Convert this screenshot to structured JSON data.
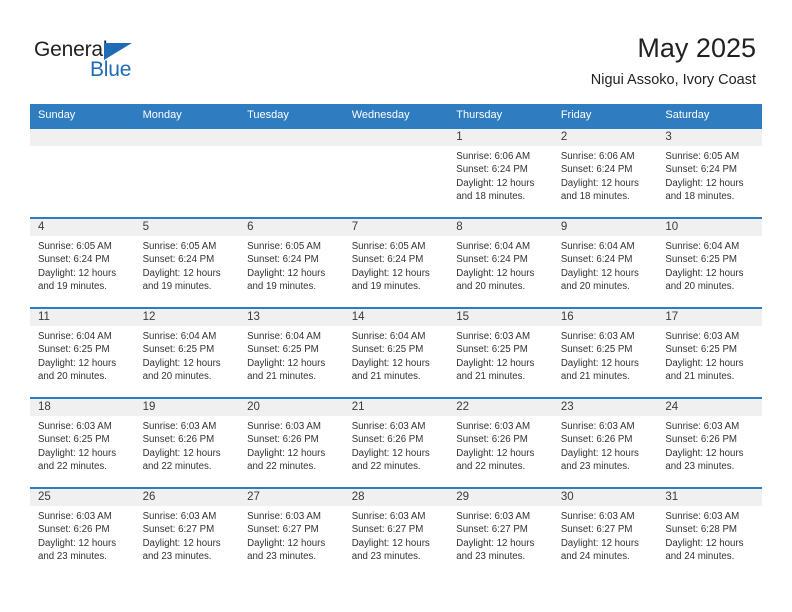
{
  "brand": {
    "name_top": "General",
    "name_bottom": "Blue",
    "accent_color": "#1f6cb4"
  },
  "header": {
    "title": "May 2025",
    "subtitle": "Nigui Assoko, Ivory Coast"
  },
  "theme": {
    "header_row_color": "#2f7cc0",
    "daynum_band_color": "#f0f0f0",
    "cell_background": "#ffffff",
    "text_color": "#333333"
  },
  "weekday_headers": [
    "Sunday",
    "Monday",
    "Tuesday",
    "Wednesday",
    "Thursday",
    "Friday",
    "Saturday"
  ],
  "weeks": [
    [
      {
        "day": "",
        "sunrise": "",
        "sunset": "",
        "daylight_line1": "",
        "daylight_line2": ""
      },
      {
        "day": "",
        "sunrise": "",
        "sunset": "",
        "daylight_line1": "",
        "daylight_line2": ""
      },
      {
        "day": "",
        "sunrise": "",
        "sunset": "",
        "daylight_line1": "",
        "daylight_line2": ""
      },
      {
        "day": "",
        "sunrise": "",
        "sunset": "",
        "daylight_line1": "",
        "daylight_line2": ""
      },
      {
        "day": "1",
        "sunrise": "Sunrise: 6:06 AM",
        "sunset": "Sunset: 6:24 PM",
        "daylight_line1": "Daylight: 12 hours",
        "daylight_line2": "and 18 minutes."
      },
      {
        "day": "2",
        "sunrise": "Sunrise: 6:06 AM",
        "sunset": "Sunset: 6:24 PM",
        "daylight_line1": "Daylight: 12 hours",
        "daylight_line2": "and 18 minutes."
      },
      {
        "day": "3",
        "sunrise": "Sunrise: 6:05 AM",
        "sunset": "Sunset: 6:24 PM",
        "daylight_line1": "Daylight: 12 hours",
        "daylight_line2": "and 18 minutes."
      }
    ],
    [
      {
        "day": "4",
        "sunrise": "Sunrise: 6:05 AM",
        "sunset": "Sunset: 6:24 PM",
        "daylight_line1": "Daylight: 12 hours",
        "daylight_line2": "and 19 minutes."
      },
      {
        "day": "5",
        "sunrise": "Sunrise: 6:05 AM",
        "sunset": "Sunset: 6:24 PM",
        "daylight_line1": "Daylight: 12 hours",
        "daylight_line2": "and 19 minutes."
      },
      {
        "day": "6",
        "sunrise": "Sunrise: 6:05 AM",
        "sunset": "Sunset: 6:24 PM",
        "daylight_line1": "Daylight: 12 hours",
        "daylight_line2": "and 19 minutes."
      },
      {
        "day": "7",
        "sunrise": "Sunrise: 6:05 AM",
        "sunset": "Sunset: 6:24 PM",
        "daylight_line1": "Daylight: 12 hours",
        "daylight_line2": "and 19 minutes."
      },
      {
        "day": "8",
        "sunrise": "Sunrise: 6:04 AM",
        "sunset": "Sunset: 6:24 PM",
        "daylight_line1": "Daylight: 12 hours",
        "daylight_line2": "and 20 minutes."
      },
      {
        "day": "9",
        "sunrise": "Sunrise: 6:04 AM",
        "sunset": "Sunset: 6:24 PM",
        "daylight_line1": "Daylight: 12 hours",
        "daylight_line2": "and 20 minutes."
      },
      {
        "day": "10",
        "sunrise": "Sunrise: 6:04 AM",
        "sunset": "Sunset: 6:25 PM",
        "daylight_line1": "Daylight: 12 hours",
        "daylight_line2": "and 20 minutes."
      }
    ],
    [
      {
        "day": "11",
        "sunrise": "Sunrise: 6:04 AM",
        "sunset": "Sunset: 6:25 PM",
        "daylight_line1": "Daylight: 12 hours",
        "daylight_line2": "and 20 minutes."
      },
      {
        "day": "12",
        "sunrise": "Sunrise: 6:04 AM",
        "sunset": "Sunset: 6:25 PM",
        "daylight_line1": "Daylight: 12 hours",
        "daylight_line2": "and 20 minutes."
      },
      {
        "day": "13",
        "sunrise": "Sunrise: 6:04 AM",
        "sunset": "Sunset: 6:25 PM",
        "daylight_line1": "Daylight: 12 hours",
        "daylight_line2": "and 21 minutes."
      },
      {
        "day": "14",
        "sunrise": "Sunrise: 6:04 AM",
        "sunset": "Sunset: 6:25 PM",
        "daylight_line1": "Daylight: 12 hours",
        "daylight_line2": "and 21 minutes."
      },
      {
        "day": "15",
        "sunrise": "Sunrise: 6:03 AM",
        "sunset": "Sunset: 6:25 PM",
        "daylight_line1": "Daylight: 12 hours",
        "daylight_line2": "and 21 minutes."
      },
      {
        "day": "16",
        "sunrise": "Sunrise: 6:03 AM",
        "sunset": "Sunset: 6:25 PM",
        "daylight_line1": "Daylight: 12 hours",
        "daylight_line2": "and 21 minutes."
      },
      {
        "day": "17",
        "sunrise": "Sunrise: 6:03 AM",
        "sunset": "Sunset: 6:25 PM",
        "daylight_line1": "Daylight: 12 hours",
        "daylight_line2": "and 21 minutes."
      }
    ],
    [
      {
        "day": "18",
        "sunrise": "Sunrise: 6:03 AM",
        "sunset": "Sunset: 6:25 PM",
        "daylight_line1": "Daylight: 12 hours",
        "daylight_line2": "and 22 minutes."
      },
      {
        "day": "19",
        "sunrise": "Sunrise: 6:03 AM",
        "sunset": "Sunset: 6:26 PM",
        "daylight_line1": "Daylight: 12 hours",
        "daylight_line2": "and 22 minutes."
      },
      {
        "day": "20",
        "sunrise": "Sunrise: 6:03 AM",
        "sunset": "Sunset: 6:26 PM",
        "daylight_line1": "Daylight: 12 hours",
        "daylight_line2": "and 22 minutes."
      },
      {
        "day": "21",
        "sunrise": "Sunrise: 6:03 AM",
        "sunset": "Sunset: 6:26 PM",
        "daylight_line1": "Daylight: 12 hours",
        "daylight_line2": "and 22 minutes."
      },
      {
        "day": "22",
        "sunrise": "Sunrise: 6:03 AM",
        "sunset": "Sunset: 6:26 PM",
        "daylight_line1": "Daylight: 12 hours",
        "daylight_line2": "and 22 minutes."
      },
      {
        "day": "23",
        "sunrise": "Sunrise: 6:03 AM",
        "sunset": "Sunset: 6:26 PM",
        "daylight_line1": "Daylight: 12 hours",
        "daylight_line2": "and 23 minutes."
      },
      {
        "day": "24",
        "sunrise": "Sunrise: 6:03 AM",
        "sunset": "Sunset: 6:26 PM",
        "daylight_line1": "Daylight: 12 hours",
        "daylight_line2": "and 23 minutes."
      }
    ],
    [
      {
        "day": "25",
        "sunrise": "Sunrise: 6:03 AM",
        "sunset": "Sunset: 6:26 PM",
        "daylight_line1": "Daylight: 12 hours",
        "daylight_line2": "and 23 minutes."
      },
      {
        "day": "26",
        "sunrise": "Sunrise: 6:03 AM",
        "sunset": "Sunset: 6:27 PM",
        "daylight_line1": "Daylight: 12 hours",
        "daylight_line2": "and 23 minutes."
      },
      {
        "day": "27",
        "sunrise": "Sunrise: 6:03 AM",
        "sunset": "Sunset: 6:27 PM",
        "daylight_line1": "Daylight: 12 hours",
        "daylight_line2": "and 23 minutes."
      },
      {
        "day": "28",
        "sunrise": "Sunrise: 6:03 AM",
        "sunset": "Sunset: 6:27 PM",
        "daylight_line1": "Daylight: 12 hours",
        "daylight_line2": "and 23 minutes."
      },
      {
        "day": "29",
        "sunrise": "Sunrise: 6:03 AM",
        "sunset": "Sunset: 6:27 PM",
        "daylight_line1": "Daylight: 12 hours",
        "daylight_line2": "and 23 minutes."
      },
      {
        "day": "30",
        "sunrise": "Sunrise: 6:03 AM",
        "sunset": "Sunset: 6:27 PM",
        "daylight_line1": "Daylight: 12 hours",
        "daylight_line2": "and 24 minutes."
      },
      {
        "day": "31",
        "sunrise": "Sunrise: 6:03 AM",
        "sunset": "Sunset: 6:28 PM",
        "daylight_line1": "Daylight: 12 hours",
        "daylight_line2": "and 24 minutes."
      }
    ]
  ]
}
